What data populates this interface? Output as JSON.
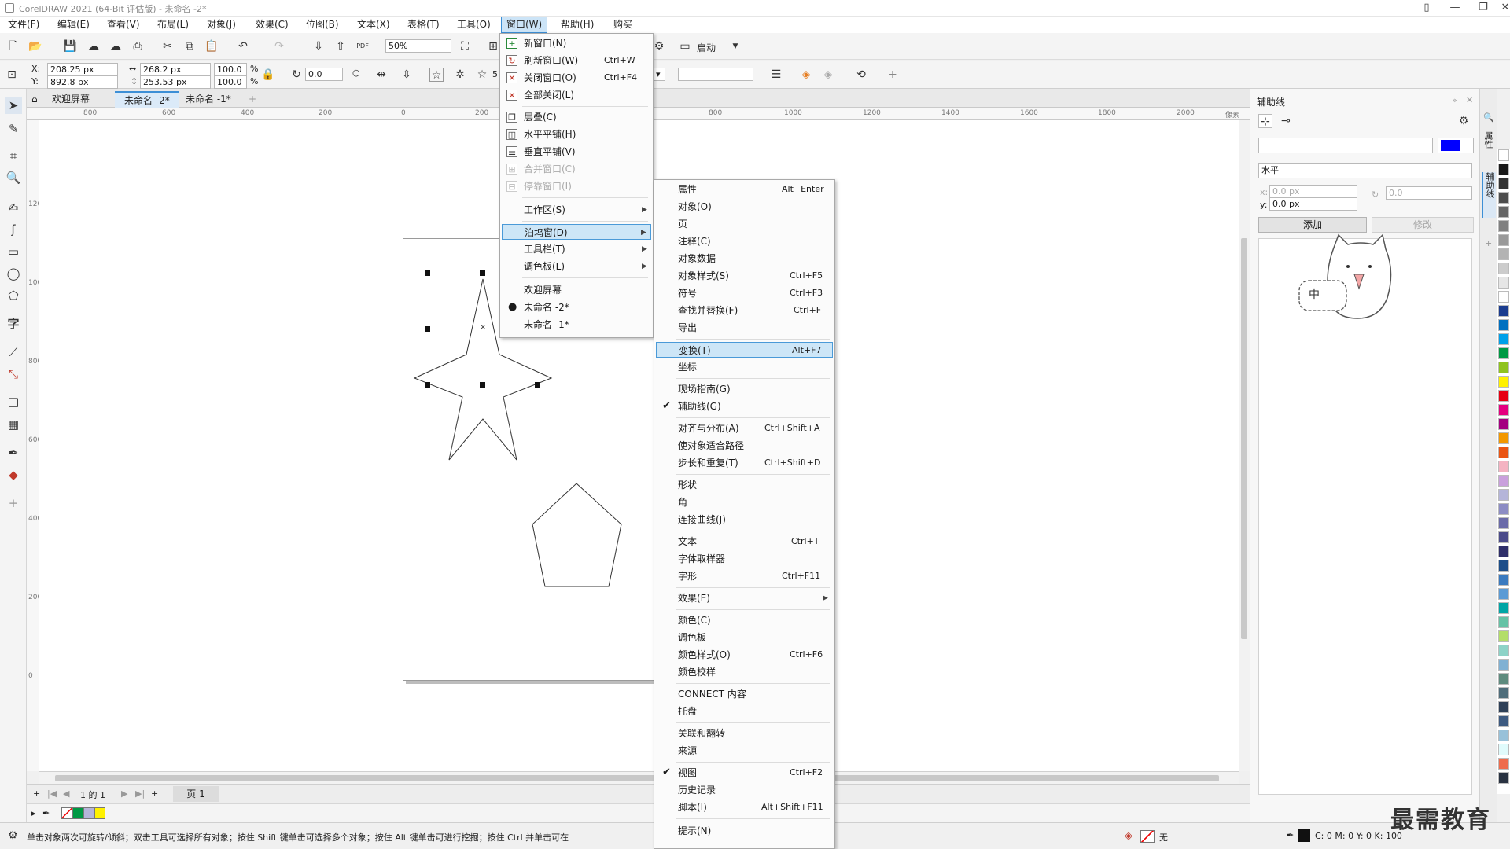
{
  "window": {
    "title": "CorelDRAW 2021 (64-Bit 评估版) - 未命名 -2*"
  },
  "menubar": [
    "文件(F)",
    "编辑(E)",
    "查看(V)",
    "布局(L)",
    "对象(J)",
    "效果(C)",
    "位图(B)",
    "文本(X)",
    "表格(T)",
    "工具(O)",
    "窗口(W)",
    "帮助(H)",
    "购买"
  ],
  "toolbar": {
    "zoom": "50%",
    "start_label": "启动"
  },
  "propbar": {
    "x_label": "X:",
    "y_label": "Y:",
    "x": "208.25 px",
    "y": "892.8 px",
    "w": "268.2 px",
    "h": "253.53 px",
    "sx": "100.0",
    "sy": "100.0",
    "pct": "%",
    "angle": "0.0",
    "points": "5"
  },
  "doctabs": [
    "欢迎屏幕",
    "未命名 -2*",
    "未命名 -1*"
  ],
  "hruler": [
    "800",
    "600",
    "400",
    "200",
    "0",
    "200",
    "800",
    "1000",
    "1200",
    "1400",
    "1600",
    "1800",
    "2000",
    "像素"
  ],
  "vruler": [
    "1200",
    "1000",
    "800",
    "600",
    "400",
    "200",
    "0"
  ],
  "pagenav": {
    "page_of": "1 的 1",
    "page_tab": "页 1"
  },
  "window_menu": [
    {
      "label": "新窗口(N)",
      "shortcut": ""
    },
    {
      "label": "刷新窗口(W)",
      "shortcut": "Ctrl+W"
    },
    {
      "label": "关闭窗口(O)",
      "shortcut": "Ctrl+F4"
    },
    {
      "label": "全部关闭(L)",
      "shortcut": ""
    },
    {
      "label": "层叠(C)",
      "shortcut": ""
    },
    {
      "label": "水平平铺(H)",
      "shortcut": ""
    },
    {
      "label": "垂直平铺(V)",
      "shortcut": ""
    },
    {
      "label": "合并窗口(C)",
      "shortcut": ""
    },
    {
      "label": "停靠窗口(I)",
      "shortcut": ""
    },
    {
      "label": "工作区(S)",
      "shortcut": ""
    },
    {
      "label": "泊坞窗(D)",
      "shortcut": ""
    },
    {
      "label": "工具栏(T)",
      "shortcut": ""
    },
    {
      "label": "调色板(L)",
      "shortcut": ""
    },
    {
      "label": "欢迎屏幕",
      "shortcut": ""
    },
    {
      "label": "未命名 -2*",
      "shortcut": ""
    },
    {
      "label": "未命名 -1*",
      "shortcut": ""
    }
  ],
  "docker_menu": [
    {
      "label": "属性",
      "shortcut": "Alt+Enter"
    },
    {
      "label": "对象(O)",
      "shortcut": ""
    },
    {
      "label": "页",
      "shortcut": ""
    },
    {
      "label": "注释(C)",
      "shortcut": ""
    },
    {
      "label": "对象数据",
      "shortcut": ""
    },
    {
      "label": "对象样式(S)",
      "shortcut": "Ctrl+F5"
    },
    {
      "label": "符号",
      "shortcut": "Ctrl+F3"
    },
    {
      "label": "查找并替换(F)",
      "shortcut": "Ctrl+F"
    },
    {
      "label": "导出",
      "shortcut": ""
    },
    {
      "label": "变换(T)",
      "shortcut": "Alt+F7"
    },
    {
      "label": "坐标",
      "shortcut": ""
    },
    {
      "label": "现场指南(G)",
      "shortcut": ""
    },
    {
      "label": "辅助线(G)",
      "shortcut": ""
    },
    {
      "label": "对齐与分布(A)",
      "shortcut": "Ctrl+Shift+A"
    },
    {
      "label": "使对象适合路径",
      "shortcut": ""
    },
    {
      "label": "步长和重复(T)",
      "shortcut": "Ctrl+Shift+D"
    },
    {
      "label": "形状",
      "shortcut": ""
    },
    {
      "label": "角",
      "shortcut": ""
    },
    {
      "label": "连接曲线(J)",
      "shortcut": ""
    },
    {
      "label": "文本",
      "shortcut": "Ctrl+T"
    },
    {
      "label": "字体取样器",
      "shortcut": ""
    },
    {
      "label": "字形",
      "shortcut": "Ctrl+F11"
    },
    {
      "label": "效果(E)",
      "shortcut": ""
    },
    {
      "label": "颜色(C)",
      "shortcut": ""
    },
    {
      "label": "调色板",
      "shortcut": ""
    },
    {
      "label": "颜色样式(O)",
      "shortcut": "Ctrl+F6"
    },
    {
      "label": "颜色校样",
      "shortcut": ""
    },
    {
      "label": "CONNECT 内容",
      "shortcut": ""
    },
    {
      "label": "托盘",
      "shortcut": ""
    },
    {
      "label": "关联和翻转",
      "shortcut": ""
    },
    {
      "label": "来源",
      "shortcut": ""
    },
    {
      "label": "视图",
      "shortcut": "Ctrl+F2"
    },
    {
      "label": "历史记录",
      "shortcut": ""
    },
    {
      "label": "脚本(I)",
      "shortcut": "Alt+Shift+F11"
    },
    {
      "label": "提示(N)",
      "shortcut": ""
    }
  ],
  "docker": {
    "title": "辅助线",
    "orientation": "水平",
    "x": "0.0 px",
    "y": "0.0 px",
    "x_label": "x:",
    "y_label": "y:",
    "angle": "0.0",
    "add_label": "添加",
    "modify_label": "修改",
    "side_tabs": [
      "属性",
      "辅助线"
    ],
    "line_color": "#0000ff"
  },
  "statusbar": {
    "hint": "单击对象两次可旋转/倾斜；双击工具可选择所有对象；按住 Shift 键单击可选择多个对象；按住 Alt 键单击可进行挖掘；按住 Ctrl 并单击可在",
    "fill_none": "无",
    "cmyk": "C: 0 M: 0 Y: 0 K: 100"
  },
  "watermark": "最需教育",
  "sticker_text": "中",
  "palette_colors": [
    "#ffffff",
    "#1a1a1a",
    "#333333",
    "#4d4d4d",
    "#666666",
    "#808080",
    "#999999",
    "#b3b3b3",
    "#cccccc",
    "#e6e6e6",
    "#ffffff",
    "#1b3c8f",
    "#0070c0",
    "#00a0e9",
    "#009944",
    "#8fc31f",
    "#fff100",
    "#e60012",
    "#e4007f",
    "#a40080",
    "#f39800",
    "#ea5514",
    "#f4b3c2",
    "#c9a0dc",
    "#b5b5d9",
    "#8c8cc4",
    "#6a6aa8",
    "#4b4b8a",
    "#2f2f6a",
    "#1d4e89",
    "#3a7abf",
    "#5b9bd5",
    "#00a6a6",
    "#66c2a5",
    "#b3de69",
    "#8dd3c7",
    "#80b1d3",
    "#5e8b7e",
    "#4f6d7a",
    "#2e4057",
    "#3d5a80",
    "#98c1d9",
    "#e0fbfc",
    "#ee6c4d",
    "#293241"
  ]
}
